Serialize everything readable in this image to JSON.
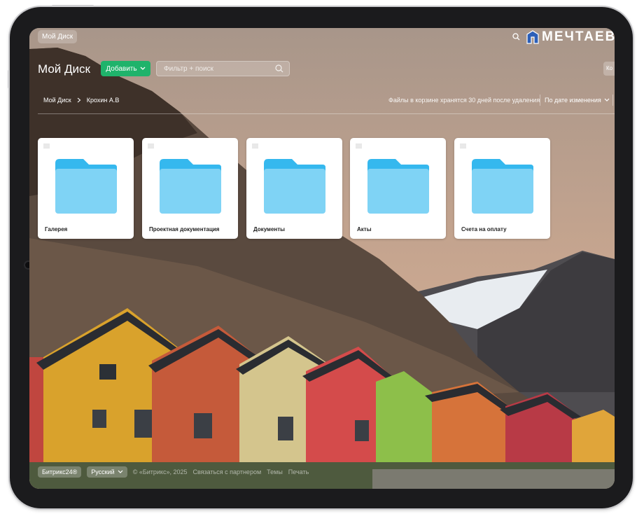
{
  "topbar": {
    "my_disk_pill": "Мой Диск",
    "logo_text": "МЕЧТАЕВО",
    "logo_color": "#2c5fb8"
  },
  "header": {
    "title": "Мой Диск",
    "add_button": "Добавить",
    "search_placeholder": "Фильтр + поиск",
    "right_button_partial": "Ко"
  },
  "breadcrumb": {
    "root": "Мой Диск",
    "current": "Крохин А.В"
  },
  "toolbar": {
    "trash_notice": "Файлы в корзине хранятся 30 дней после удаления",
    "sort_label": "По дате изменения"
  },
  "folders": [
    {
      "name": "Галерея"
    },
    {
      "name": "Проектная документация"
    },
    {
      "name": "Документы"
    },
    {
      "name": "Акты"
    },
    {
      "name": "Счета на оплату"
    }
  ],
  "footer": {
    "brand": "Битрикс24®",
    "language": "Русский",
    "copyright": "© «Битрикс», 2025",
    "partner_link": "Связаться с партнером",
    "themes_link": "Темы",
    "print_link": "Печать"
  },
  "colors": {
    "accent_green": "#1fb36b",
    "folder_blue": "#7fd3f5",
    "folder_tab_blue": "#35b8ee"
  }
}
